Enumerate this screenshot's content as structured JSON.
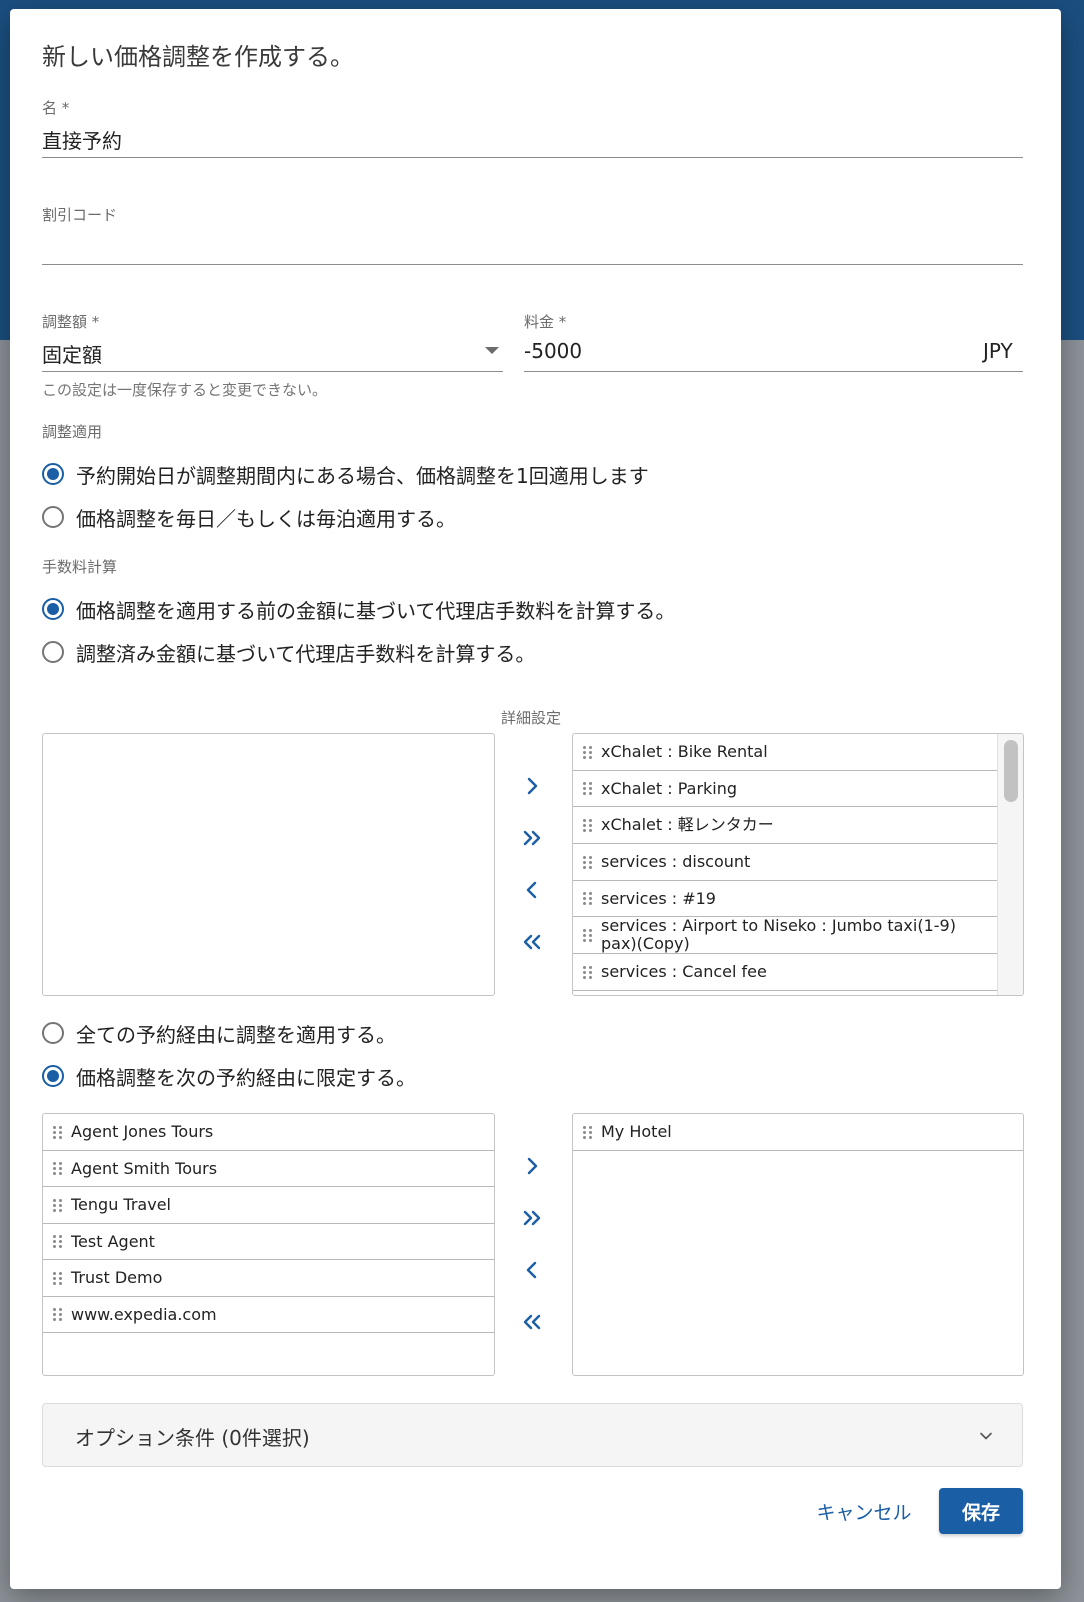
{
  "dialog": {
    "title": "新しい価格調整を作成する。",
    "name_field": {
      "label": "名 *",
      "value": "直接予約"
    },
    "discount_code_field": {
      "label": "割引コード",
      "value": ""
    },
    "adjustment_type": {
      "label": "調整額 *",
      "value": "固定額",
      "hint": "この設定は一度保存すると変更できない。"
    },
    "amount": {
      "label": "料金 *",
      "value": "-5000",
      "currency": "JPY"
    },
    "apply_section": {
      "label": "調整適用",
      "options": [
        {
          "label": "予約開始日が調整期間内にある場合、価格調整を1回適用します",
          "selected": true
        },
        {
          "label": "価格調整を毎日／もしくは毎泊適用する。",
          "selected": false
        }
      ]
    },
    "fee_section": {
      "label": "手数料計算",
      "options": [
        {
          "label": "価格調整を適用する前の金額に基づいて代理店手数料を計算する。",
          "selected": true
        },
        {
          "label": "調整済み金額に基づいて代理店手数料を計算する。",
          "selected": false
        }
      ]
    },
    "details": {
      "label": "詳細設定",
      "available": [],
      "selected": [
        "xChalet : Bike Rental",
        "xChalet : Parking",
        "xChalet : 軽レンタカー",
        "services : discount",
        "services : #19",
        "services : Airport to Niseko : Jumbo taxi(1-9) pax)(Copy)",
        "services : Cancel fee"
      ]
    },
    "channel_section": {
      "options": [
        {
          "label": "全ての予約経由に調整を適用する。",
          "selected": false
        },
        {
          "label": "価格調整を次の予約経由に限定する。",
          "selected": true
        }
      ],
      "available": [
        "Agent Jones Tours",
        "Agent Smith Tours",
        "Tengu Travel",
        "Test Agent",
        "Trust Demo",
        "www.expedia.com"
      ],
      "selected": [
        "My Hotel"
      ]
    },
    "options_panel": {
      "label": "オプション条件 (0件選択)"
    },
    "buttons": {
      "cancel": "キャンセル",
      "save": "保存"
    },
    "accent_color": "#1a5ea6"
  }
}
